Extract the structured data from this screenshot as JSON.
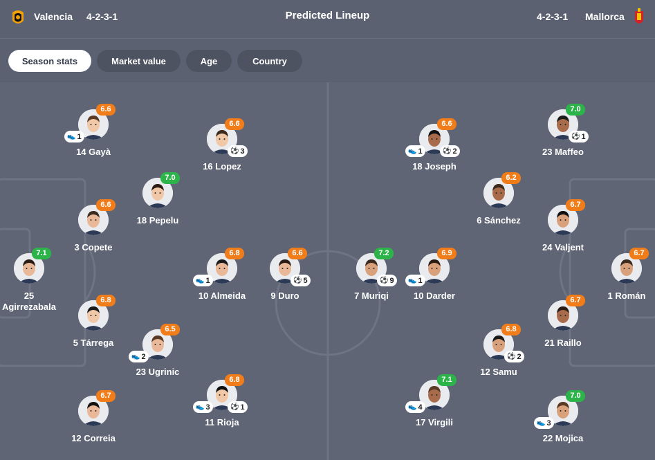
{
  "header": {
    "title": "Predicted Lineup",
    "home": {
      "name": "Valencia",
      "formation": "4-2-3-1"
    },
    "away": {
      "name": "Mallorca",
      "formation": "4-2-3-1"
    }
  },
  "tabs": [
    {
      "label": "Season stats",
      "active": true
    },
    {
      "label": "Market value",
      "active": false
    },
    {
      "label": "Age",
      "active": false
    },
    {
      "label": "Country",
      "active": false
    }
  ],
  "colors": {
    "rating_high": "#2cb34a",
    "rating_mid": "#f07d1a",
    "pitch": "#5f6575"
  },
  "home_players": [
    {
      "name": "25\nAgirrezabala",
      "rating": "7.1",
      "rating_color": "green"
    },
    {
      "name": "14 Gayà",
      "rating": "6.6",
      "rating_color": "orange",
      "assists": "1"
    },
    {
      "name": "3 Copete",
      "rating": "6.6",
      "rating_color": "orange"
    },
    {
      "name": "5 Tárrega",
      "rating": "6.8",
      "rating_color": "orange"
    },
    {
      "name": "12 Correia",
      "rating": "6.7",
      "rating_color": "orange"
    },
    {
      "name": "18 Pepelu",
      "rating": "7.0",
      "rating_color": "green"
    },
    {
      "name": "23 Ugrinic",
      "rating": "6.5",
      "rating_color": "orange",
      "assists": "2"
    },
    {
      "name": "16 Lopez",
      "rating": "6.6",
      "rating_color": "orange",
      "goals": "3"
    },
    {
      "name": "10 Almeida",
      "rating": "6.8",
      "rating_color": "orange",
      "assists": "1"
    },
    {
      "name": "11 Rioja",
      "rating": "6.8",
      "rating_color": "orange",
      "assists": "3",
      "goals": "1"
    },
    {
      "name": "9 Duro",
      "rating": "6.6",
      "rating_color": "orange",
      "goals": "5"
    }
  ],
  "away_players": [
    {
      "name": "1 Román",
      "rating": "6.7",
      "rating_color": "orange"
    },
    {
      "name": "23 Maffeo",
      "rating": "7.0",
      "rating_color": "green",
      "goals": "1"
    },
    {
      "name": "24 Valjent",
      "rating": "6.7",
      "rating_color": "orange"
    },
    {
      "name": "21 Raillo",
      "rating": "6.7",
      "rating_color": "orange"
    },
    {
      "name": "22 Mojica",
      "rating": "7.0",
      "rating_color": "green",
      "assists": "3"
    },
    {
      "name": "6 Sánchez",
      "rating": "6.2",
      "rating_color": "orange"
    },
    {
      "name": "12 Samu",
      "rating": "6.8",
      "rating_color": "orange",
      "goals": "2"
    },
    {
      "name": "18 Joseph",
      "rating": "6.6",
      "rating_color": "orange",
      "assists": "1",
      "goals": "2"
    },
    {
      "name": "10 Darder",
      "rating": "6.9",
      "rating_color": "orange",
      "assists": "1"
    },
    {
      "name": "17 Virgili",
      "rating": "7.1",
      "rating_color": "green",
      "assists": "4"
    },
    {
      "name": "7 Muriqi",
      "rating": "7.2",
      "rating_color": "green",
      "goals": "9"
    }
  ]
}
